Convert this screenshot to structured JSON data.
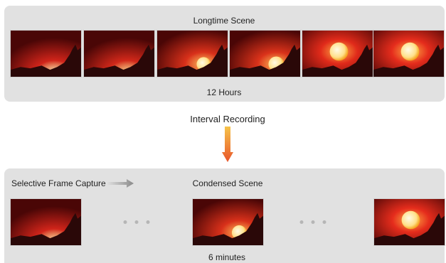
{
  "top_panel": {
    "title": "Longtime Scene",
    "duration": "12 Hours",
    "frames": [
      {
        "sun": "hidden",
        "sky": "#d0241a",
        "sun_size": 0,
        "glow": 0.35
      },
      {
        "sun": "hidden",
        "sky": "#d2281a",
        "sun_size": 0,
        "glow": 0.55
      },
      {
        "sun": "rising",
        "sky": "#d8301a",
        "sun_size": 16,
        "glow": 0.85
      },
      {
        "sun": "rising",
        "sky": "#da321a",
        "sun_size": 18,
        "glow": 0.9
      },
      {
        "sun": "risen",
        "sky": "#e02a1a",
        "sun_size": 22,
        "glow": 1.0
      },
      {
        "sun": "risen",
        "sky": "#e52c1c",
        "sun_size": 22,
        "glow": 1.0
      }
    ]
  },
  "middle": {
    "label": "Interval Recording",
    "arrow_color_top": "#f6c34a",
    "arrow_color_bottom": "#e8542a"
  },
  "bottom_panel": {
    "capture_label": "Selective Frame Capture",
    "title": "Condensed Scene",
    "duration": "6 minutes",
    "frames": [
      {
        "sun": "hidden",
        "sky": "#d0241a",
        "sun_size": 0,
        "glow": 0.45
      },
      {
        "sun": "rising",
        "sky": "#d8301a",
        "sun_size": 17,
        "glow": 0.9
      },
      {
        "sun": "risen",
        "sky": "#e52c1c",
        "sun_size": 22,
        "glow": 1.0
      }
    ]
  },
  "colors": {
    "panel_bg": "#e1e1e1",
    "dots": "#b6b6b6"
  }
}
